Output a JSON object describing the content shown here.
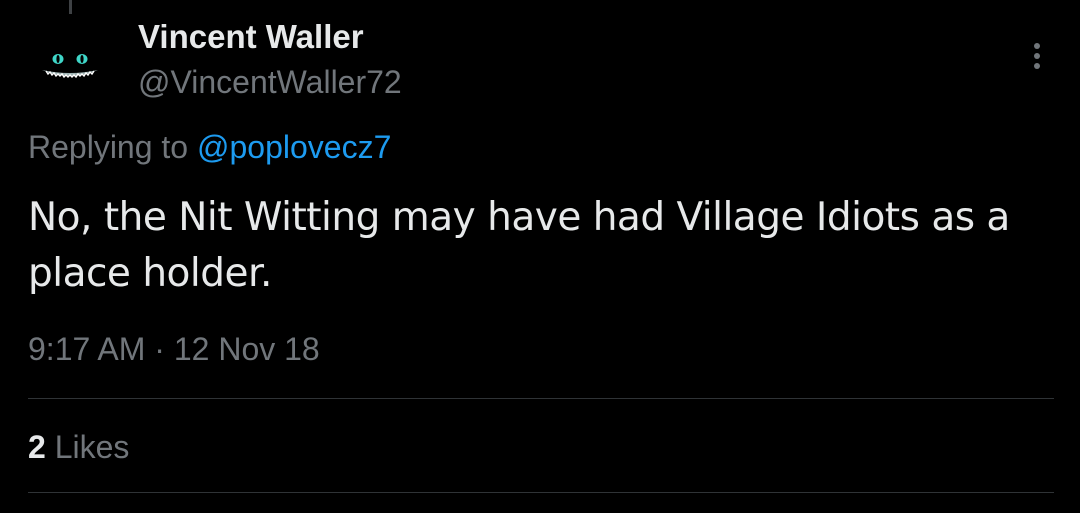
{
  "tweet": {
    "author": {
      "name": "Vincent Waller",
      "handle": "@VincentWaller72"
    },
    "reply": {
      "prefix": "Replying to",
      "handle": "@poplovecz7"
    },
    "text": "No, the Nit Witting may have had Village Idiots as a place holder.",
    "time": "9:17 AM",
    "separator": "·",
    "date": "12 Nov 18",
    "likes": {
      "count": "2",
      "label": "Likes"
    }
  },
  "icons": {
    "avatar": "cheshire-cat-grin-avatar",
    "more": "more-vertical-icon"
  },
  "colors": {
    "background": "#000000",
    "text_primary": "#e7e9ea",
    "text_secondary": "#71767b",
    "link": "#1d9bf0",
    "divider": "#2f3336"
  }
}
